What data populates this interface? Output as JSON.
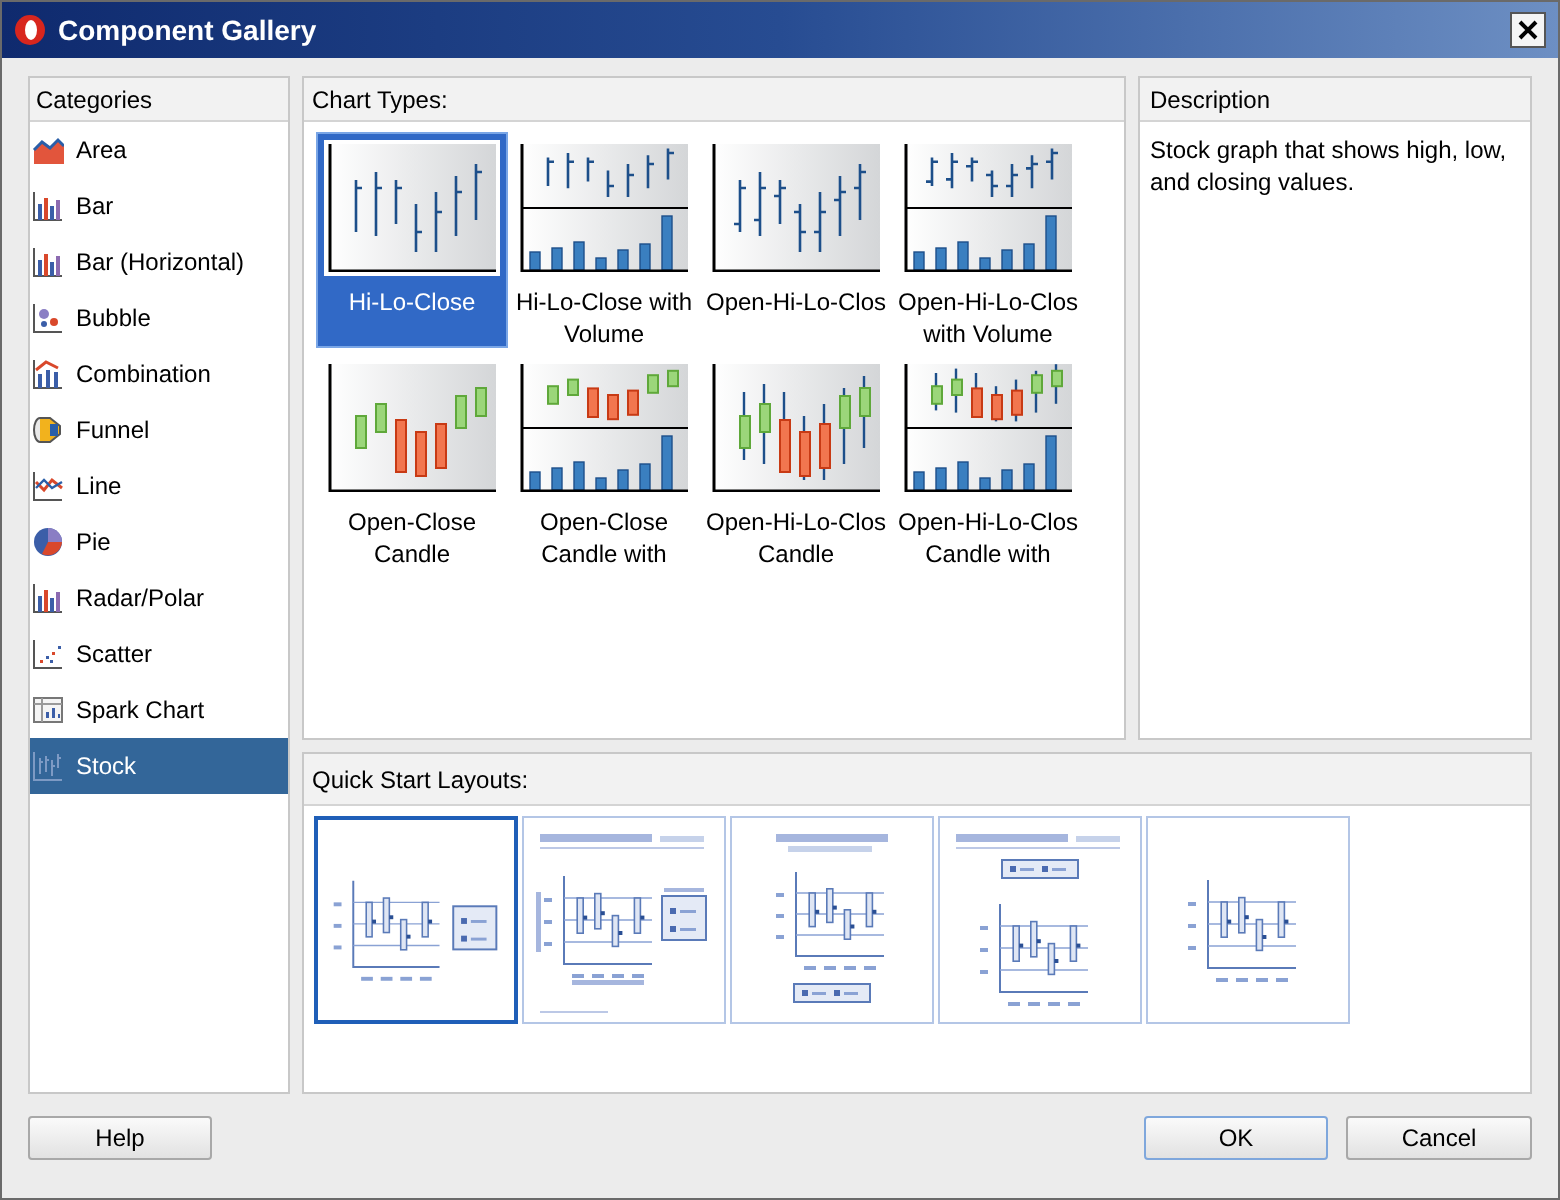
{
  "window": {
    "title": "Component Gallery"
  },
  "categories": {
    "heading": "Categories",
    "items": [
      {
        "label": "Area",
        "kind": "area",
        "selected": false
      },
      {
        "label": "Bar",
        "kind": "bar",
        "selected": false
      },
      {
        "label": "Bar (Horizontal)",
        "kind": "bar",
        "selected": false
      },
      {
        "label": "Bubble",
        "kind": "bubble",
        "selected": false
      },
      {
        "label": "Combination",
        "kind": "combination",
        "selected": false
      },
      {
        "label": "Funnel",
        "kind": "funnel",
        "selected": false
      },
      {
        "label": "Line",
        "kind": "line",
        "selected": false
      },
      {
        "label": "Pie",
        "kind": "pie",
        "selected": false
      },
      {
        "label": "Radar/Polar",
        "kind": "bar",
        "selected": false
      },
      {
        "label": "Scatter",
        "kind": "scatter",
        "selected": false
      },
      {
        "label": "Spark Chart",
        "kind": "spark",
        "selected": false
      },
      {
        "label": "Stock",
        "kind": "stock",
        "selected": true
      }
    ]
  },
  "chart_types": {
    "heading": "Chart Types:",
    "items": [
      {
        "label": "Hi-Lo-Close",
        "kind": "hlc",
        "volume": false,
        "selected": true
      },
      {
        "label": "Hi-Lo-Close with Volume",
        "kind": "hlc",
        "volume": true,
        "selected": false
      },
      {
        "label": "Open-Hi-Lo-Clos",
        "kind": "ohlc",
        "volume": false,
        "selected": false
      },
      {
        "label": "Open-Hi-Lo-Clos with Volume",
        "kind": "ohlc",
        "volume": true,
        "selected": false
      },
      {
        "label": "Open-Close Candle",
        "kind": "candle",
        "volume": false,
        "selected": false
      },
      {
        "label": "Open-Close Candle with",
        "kind": "candle",
        "volume": true,
        "selected": false
      },
      {
        "label": "Open-Hi-Lo-Clos Candle",
        "kind": "ohlc_candle",
        "volume": false,
        "selected": false
      },
      {
        "label": "Open-Hi-Lo-Clos Candle with",
        "kind": "ohlc_candle",
        "volume": true,
        "selected": false
      }
    ]
  },
  "description": {
    "heading": "Description",
    "text": "Stock graph that shows high, low, and closing values."
  },
  "quick_start_layouts": {
    "heading": "Quick Start Layouts:",
    "items": [
      {
        "kind": "legend_right",
        "selected": true
      },
      {
        "kind": "title_legend_right",
        "selected": false
      },
      {
        "kind": "title_legend_bottom",
        "selected": false
      },
      {
        "kind": "title_legend_top",
        "selected": false
      },
      {
        "kind": "plain",
        "selected": false
      }
    ]
  },
  "buttons": [
    {
      "label": "Help",
      "kind": "help"
    },
    {
      "label": "OK",
      "kind": "default"
    },
    {
      "label": "Cancel",
      "kind": "normal"
    }
  ]
}
